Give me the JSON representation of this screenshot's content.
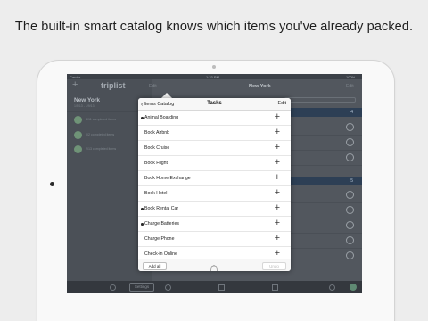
{
  "caption": "The built-in smart catalog knows which items you've already packed.",
  "status_bar": {
    "carrier": "Carrier",
    "time": "1:33 PM",
    "battery": "100%"
  },
  "app": {
    "logo": "triplist",
    "left_edit": "Edit",
    "right_title": "New York",
    "right_edit": "Edit",
    "trip": {
      "name": "New York",
      "dates": "1/5/13 - 1/9/13"
    },
    "trip_rows": [
      "4/11 completed items",
      "0/2 completed items",
      "2/13 completed items"
    ],
    "segment_label": "Items (4)",
    "bands": [
      "4",
      "5"
    ],
    "tabbar": {
      "settings_label": "Settings"
    }
  },
  "popover": {
    "back_label": "Items Catalog",
    "title": "Tasks",
    "edit_label": "Edit",
    "items": [
      {
        "label": "Animal Boarding",
        "packed": true
      },
      {
        "label": "Book Airbnb",
        "packed": false
      },
      {
        "label": "Book Cruise",
        "packed": false
      },
      {
        "label": "Book Flight",
        "packed": false
      },
      {
        "label": "Book Home Exchange",
        "packed": false
      },
      {
        "label": "Book Hotel",
        "packed": false
      },
      {
        "label": "Book Rental Car",
        "packed": true
      },
      {
        "label": "Charge Batteries",
        "packed": true
      },
      {
        "label": "Charge Phone",
        "packed": false
      },
      {
        "label": "Check-in Online",
        "packed": false
      }
    ],
    "add_all_label": "Add all",
    "undo_label": "Undo",
    "bag_icon": "bag-icon",
    "add_icon": "plus-icon"
  }
}
